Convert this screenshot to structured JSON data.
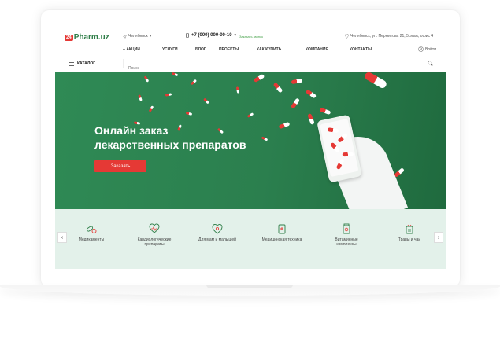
{
  "header": {
    "logo_badge": "24",
    "logo_text": "Pharm.uz",
    "city": "Челябинск",
    "phone": "+7 (000) 000-00-10",
    "callback": "Заказать звонок",
    "address": "Челябинск, ул. Пермитова 21, 5 этаж, офис 4",
    "login": "Войти"
  },
  "nav": {
    "items": [
      "Акции",
      "Услуги",
      "Блог",
      "Проекты",
      "Как купить",
      "Компания",
      "Контакты"
    ]
  },
  "catalog": {
    "label": "КАТАЛОГ",
    "search_placeholder": "Поиск"
  },
  "hero": {
    "title_line1": "Онлайн заказ",
    "title_line2": "лекарственных препаратов",
    "button": "Заказать"
  },
  "categories": [
    {
      "label_1": "Медикаменты",
      "label_2": "",
      "icon": "pills-icon"
    },
    {
      "label_1": "Кардиологические",
      "label_2": "препараты",
      "icon": "heart-icon"
    },
    {
      "label_1": "Для мам и малышей",
      "label_2": "",
      "icon": "mother-baby-icon"
    },
    {
      "label_1": "Медицинская техника",
      "label_2": "",
      "icon": "medical-device-icon"
    },
    {
      "label_1": "Витаминные",
      "label_2": "комплексы",
      "icon": "vitamins-icon"
    },
    {
      "label_1": "Травы и чаи",
      "label_2": "",
      "icon": "herbs-icon"
    }
  ],
  "colors": {
    "accent_green": "#2f8a55",
    "accent_red": "#e53935",
    "cat_bg": "#e3f1ea"
  }
}
